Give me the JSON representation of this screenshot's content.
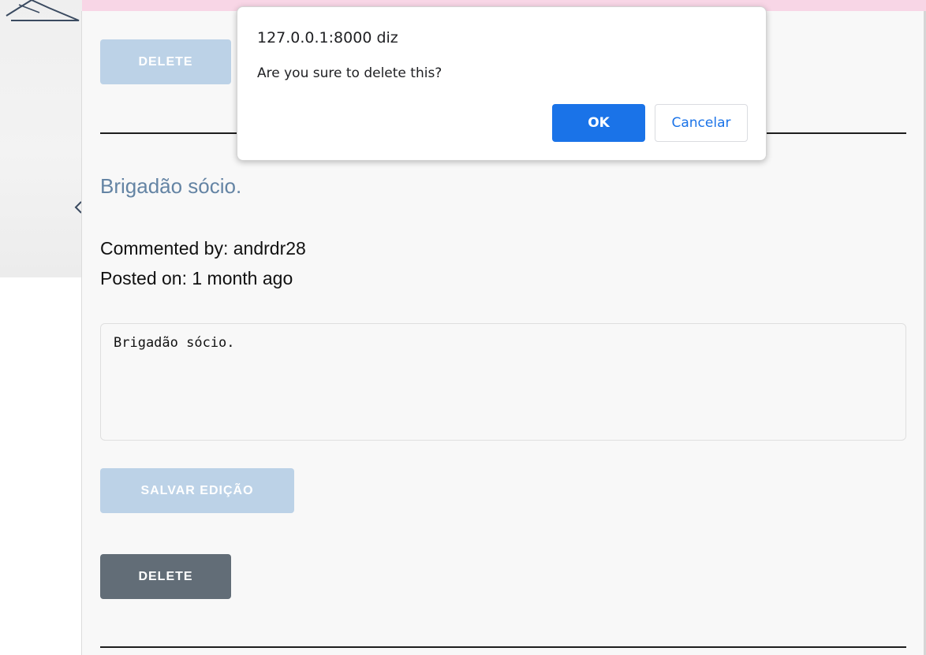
{
  "dialog": {
    "origin": "127.0.0.1:8000 diz",
    "message": "Are you sure to delete this?",
    "ok_label": "OK",
    "cancel_label": "Cancelar"
  },
  "comments": [
    {
      "delete_label": "DELETE"
    },
    {
      "title": "Brigadão sócio.",
      "commented_by": "Commented by: andrdr28",
      "posted_on": "Posted on: 1 month ago",
      "edit_text": "Brigadão sócio.",
      "save_label": "SALVAR EDIÇÃO",
      "delete_label": "DELETE"
    }
  ],
  "colors": {
    "accent": "#1a73e8",
    "disabled_button": "#bcd2e7",
    "dark_button": "#626d77",
    "title": "#6484a4"
  }
}
